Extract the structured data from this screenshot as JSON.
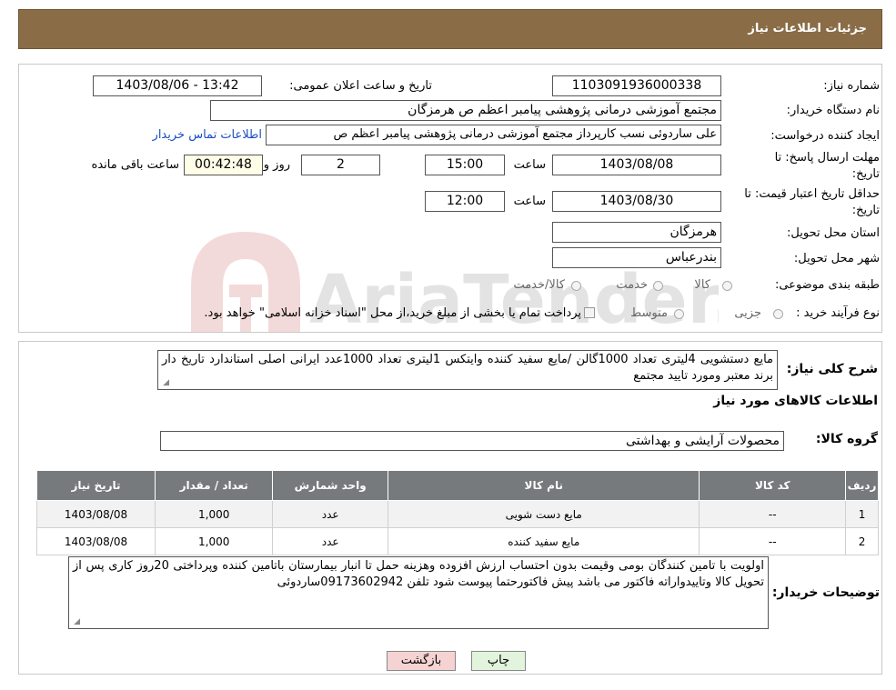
{
  "header": {
    "title": "جزئیات اطلاعات نیاز"
  },
  "form": {
    "need_number_label": "شماره نیاز:",
    "need_number": "1103091936000338",
    "announce_label": "تاریخ و ساعت اعلان عمومی:",
    "announce_value": "1403/08/06 - 13:42",
    "buyer_org_label": "نام دستگاه خریدار:",
    "buyer_org": "مجتمع آموزشی درمانی پژوهشی پیامبر اعظم ص  هرمزگان",
    "creator_label": "ایجاد کننده درخواست:",
    "creator": "علی ساردوئی نسب کارپرداز مجتمع آموزشی درمانی پژوهشی پیامبر اعظم ص",
    "contact_link": "اطلاعات تماس خریدار",
    "deadline_label": "مهلت ارسال پاسخ: تا تاریخ:",
    "deadline_date": "1403/08/08",
    "time_label": "ساعت",
    "deadline_time": "15:00",
    "days_value": "2",
    "days_label": "روز و",
    "remaining_time": "00:42:48",
    "remaining_label": "ساعت باقی مانده",
    "validity_label": "حداقل تاریخ اعتبار قیمت: تا تاریخ:",
    "validity_date": "1403/08/30",
    "validity_time": "12:00",
    "province_label": "استان محل تحویل:",
    "province": "هرمزگان",
    "city_label": "شهر محل تحویل:",
    "city": "بندرعباس",
    "category_label": "طبقه بندی موضوعی:",
    "category_options": [
      "کالا",
      "خدمت",
      "کالا/خدمت"
    ],
    "process_label": "نوع فرآیند خرید :",
    "process_options": [
      "جزیی",
      "متوسط"
    ],
    "process_note": "پرداخت تمام یا بخشی از مبلغ خرید،از محل \"اسناد خزانه اسلامی\" خواهد بود."
  },
  "details": {
    "summary_label": "شرح کلی نیاز:",
    "summary_text": "مایع دستشویی 4لیتری تعداد 1000گالن /مایع سفید کننده وایتکس 1لیتری تعداد 1000عدد  ایرانی  اصلی استاندارد تاریخ دار  برند  معتبر ومورد تایید مجتمع",
    "items_title": "اطلاعات کالاهای مورد نیاز",
    "group_label": "گروه کالا:",
    "group_value": "محصولات آرایشی و بهداشتی"
  },
  "table": {
    "headers": [
      "ردیف",
      "کد کالا",
      "نام کالا",
      "واحد شمارش",
      "تعداد / مقدار",
      "تاریخ نیاز"
    ],
    "rows": [
      [
        "1",
        "--",
        "مایع دست شویی",
        "عدد",
        "1,000",
        "1403/08/08"
      ],
      [
        "2",
        "--",
        "مایع سفید کننده",
        "عدد",
        "1,000",
        "1403/08/08"
      ]
    ]
  },
  "buyer_notes": {
    "label": "توضیحات خریدار:",
    "text": "اولویت با تامین کنندگان بومی وقیمت بدون احتساب ارزش افزوده وهزینه حمل تا انبار بیمارستان باتامین کننده وپرداختی 20روز کاری پس از تحویل کالا وتاییدواراته فاکتور می باشد پیش فاکتورحتما پیوست شود تلفن 09173602942ساردوئی"
  },
  "buttons": {
    "print": "چاپ",
    "back": "بازگشت"
  },
  "colors": {
    "header_bg": "#8a6d47",
    "table_header_bg": "#777a7c",
    "back_button_bg": "#f6d3d3",
    "print_button_bg": "#e2f5dc"
  },
  "watermark": {
    "text": "AriaTender.neT"
  }
}
